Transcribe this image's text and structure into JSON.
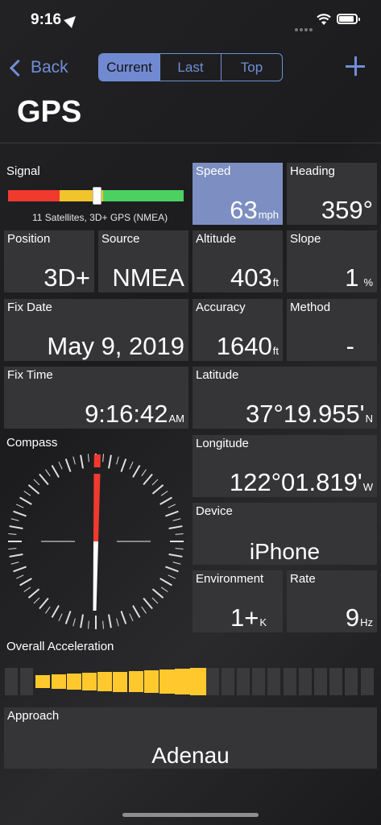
{
  "status": {
    "time": "9:16"
  },
  "nav": {
    "back_label": "Back",
    "segments": [
      "Current",
      "Last",
      "Top"
    ],
    "selected_segment": "Current",
    "title": "GPS"
  },
  "signal": {
    "label": "Signal",
    "satellites": "11 Satellites, 3D+ GPS (NMEA)",
    "colors": {
      "low": "#f03a2e",
      "mid": "#f2c42c",
      "high": "#4cd160"
    }
  },
  "tiles": {
    "speed": {
      "label": "Speed",
      "value": "63",
      "unit": "mph"
    },
    "heading": {
      "label": "Heading",
      "value": "359°"
    },
    "position": {
      "label": "Position",
      "value": "3D+"
    },
    "source": {
      "label": "Source",
      "value": "NMEA"
    },
    "altitude": {
      "label": "Altitude",
      "value": "403",
      "unit": "ft"
    },
    "slope": {
      "label": "Slope",
      "value": "1",
      "unit": "%"
    },
    "fix_date": {
      "label": "Fix Date",
      "value": "May 9, 2019"
    },
    "accuracy": {
      "label": "Accuracy",
      "value": "1640",
      "unit": "ft"
    },
    "method": {
      "label": "Method",
      "value": "-"
    },
    "fix_time": {
      "label": "Fix Time",
      "value": "9:16:42",
      "unit": "AM"
    },
    "latitude": {
      "label": "Latitude",
      "value": "37°19.955'",
      "unit": "N"
    },
    "longitude": {
      "label": "Longitude",
      "value": "122°01.819'",
      "unit": "W"
    },
    "device": {
      "label": "Device",
      "value": "iPhone"
    },
    "environment": {
      "label": "Environment",
      "value": "1+",
      "unit": "K"
    },
    "rate": {
      "label": "Rate",
      "value": "9",
      "unit": "Hz"
    },
    "approach": {
      "label": "Approach",
      "value": "Adenau"
    }
  },
  "compass": {
    "label": "Compass",
    "heading_deg": 359
  },
  "acceleration": {
    "label": "Overall Acceleration",
    "total_segments": 24,
    "lit_segments": [
      2,
      3,
      4,
      5,
      6,
      7,
      8,
      9,
      10,
      11,
      12
    ],
    "lit_color": "#ffc92e",
    "dim_color": "#3a3a3c"
  },
  "colors": {
    "accent": "#6f8fd6",
    "tile_bg": "#353537",
    "speed_highlight": "#7d8fc2"
  }
}
